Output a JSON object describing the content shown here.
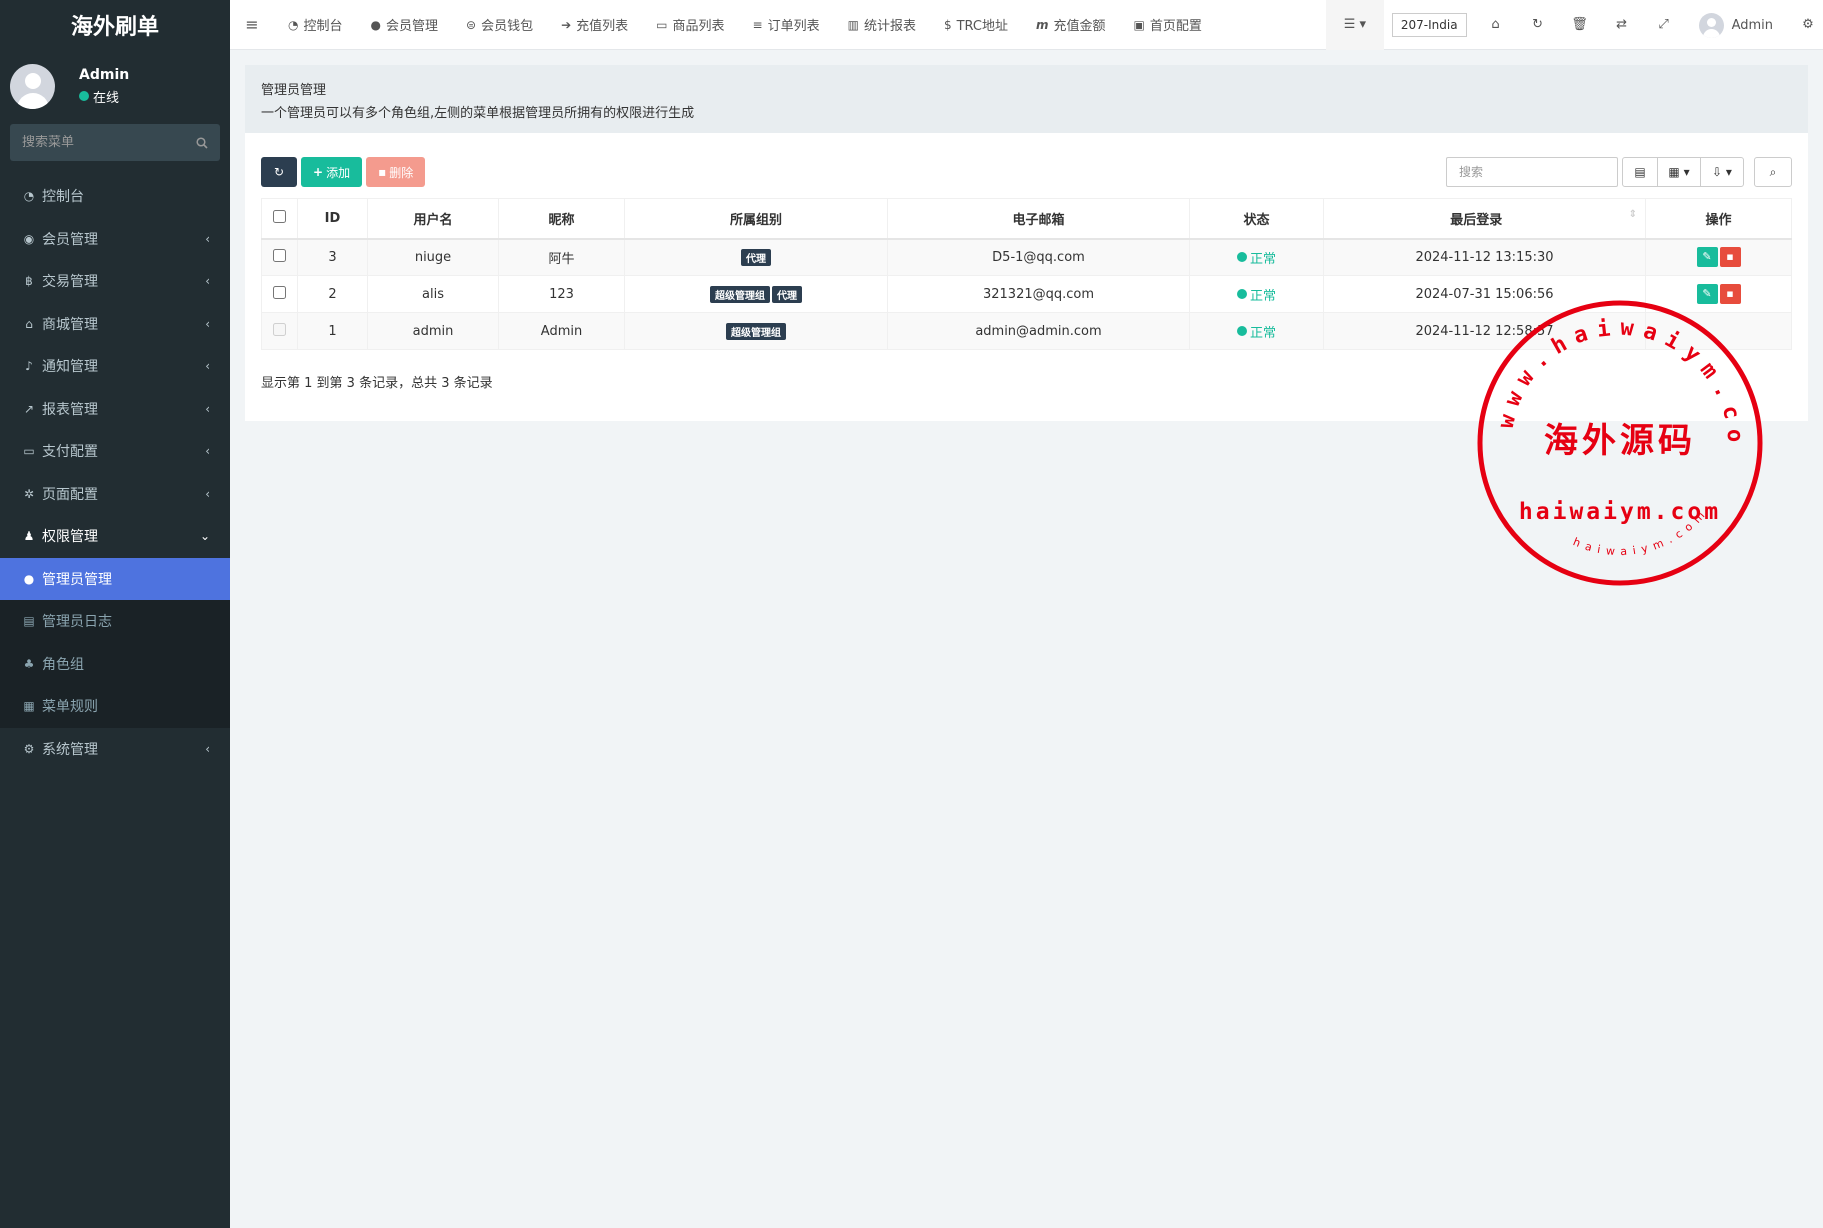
{
  "sidebar": {
    "brand": "海外刷单",
    "user": {
      "name": "Admin",
      "status": "在线"
    },
    "search_placeholder": "搜索菜单",
    "items": [
      {
        "label": "控制台",
        "icon": "dashboard-icon"
      },
      {
        "label": "会员管理",
        "icon": "user-circle-icon"
      },
      {
        "label": "交易管理",
        "icon": "bitcoin-icon"
      },
      {
        "label": "商城管理",
        "icon": "home-icon"
      },
      {
        "label": "通知管理",
        "icon": "bell-icon"
      },
      {
        "label": "报表管理",
        "icon": "line-chart-icon"
      },
      {
        "label": "支付配置",
        "icon": "credit-card-icon"
      },
      {
        "label": "页面配置",
        "icon": "gear-icon"
      },
      {
        "label": "权限管理",
        "icon": "users-icon"
      }
    ],
    "submenu": [
      {
        "label": "管理员管理",
        "icon": "user-icon"
      },
      {
        "label": "管理员日志",
        "icon": "list-icon"
      },
      {
        "label": "角色组",
        "icon": "group-icon"
      },
      {
        "label": "菜单规则",
        "icon": "bars-icon"
      }
    ],
    "last_item": {
      "label": "系统管理",
      "icon": "gears-icon"
    }
  },
  "topbar": {
    "nav": [
      {
        "label": "控制台",
        "icon": "dashboard-icon"
      },
      {
        "label": "会员管理",
        "icon": "user-icon"
      },
      {
        "label": "会员钱包",
        "icon": "wallet-icon"
      },
      {
        "label": "充值列表",
        "icon": "sign-in-icon"
      },
      {
        "label": "商品列表",
        "icon": "desktop-icon"
      },
      {
        "label": "订单列表",
        "icon": "list-icon"
      },
      {
        "label": "统计报表",
        "icon": "bar-chart-icon"
      },
      {
        "label": "TRC地址",
        "icon": "dollar-icon"
      },
      {
        "label": "充值金额",
        "icon": "money-icon"
      },
      {
        "label": "首页配置",
        "icon": "save-icon"
      }
    ],
    "site": "207-India",
    "admin_name": "Admin"
  },
  "page": {
    "title": "管理员管理",
    "description": "一个管理员可以有多个角色组,左侧的菜单根据管理员所拥有的权限进行生成"
  },
  "toolbar": {
    "add_label": "添加",
    "delete_label": "删除",
    "search_placeholder": "搜索"
  },
  "table": {
    "columns": [
      "ID",
      "用户名",
      "昵称",
      "所属组别",
      "电子邮箱",
      "状态",
      "最后登录",
      "操作"
    ],
    "rows": [
      {
        "id": "3",
        "username": "niuge",
        "nickname": "阿牛",
        "groups": [
          "代理"
        ],
        "email": "D5-1@qq.com",
        "status": "正常",
        "last_login": "2024-11-12 13:15:30"
      },
      {
        "id": "2",
        "username": "alis",
        "nickname": "123",
        "groups": [
          "超级管理组",
          "代理"
        ],
        "email": "321321@qq.com",
        "status": "正常",
        "last_login": "2024-07-31 15:06:56"
      },
      {
        "id": "1",
        "username": "admin",
        "nickname": "Admin",
        "groups": [
          "超级管理组"
        ],
        "email": "admin@admin.com",
        "status": "正常",
        "last_login": "2024-11-12 12:58:57"
      }
    ]
  },
  "pager_info": "显示第 1 到第 3 条记录，总共 3 条记录",
  "watermark": {
    "center_text": "海外源码",
    "domain": "haiwaiym.com",
    "ring_text": "www.haiwaiym.com",
    "small_text": "haiwaiym.com"
  }
}
